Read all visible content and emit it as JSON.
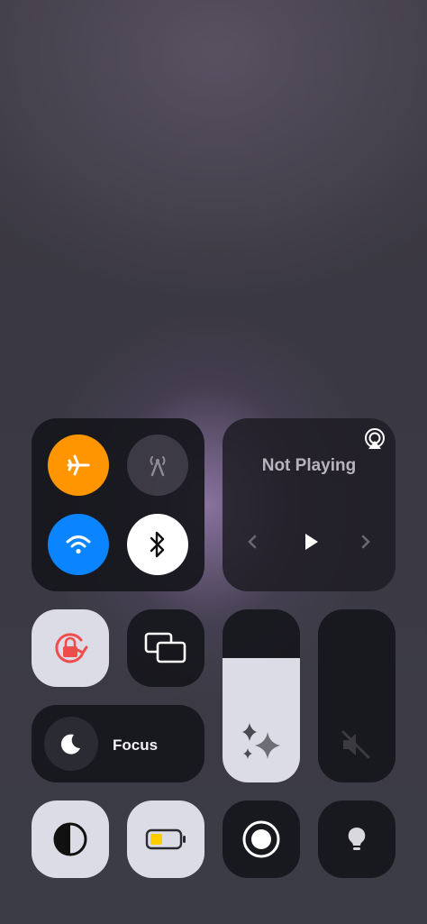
{
  "connectivity": {
    "airplane": {
      "state": "on",
      "color": "#ff9500"
    },
    "cellular": {
      "state": "off"
    },
    "wifi": {
      "state": "on",
      "color": "#0a84ff"
    },
    "bluetooth": {
      "state": "on"
    }
  },
  "now_playing": {
    "title": "Not Playing"
  },
  "controls": {
    "focus_label": "Focus"
  },
  "sliders": {
    "brightness": {
      "level": 0.72
    },
    "volume": {
      "level": 0.0,
      "muted": true
    }
  },
  "colors": {
    "lock_accent": "#ef4c4c",
    "battery_fill": "#ffcc00"
  }
}
